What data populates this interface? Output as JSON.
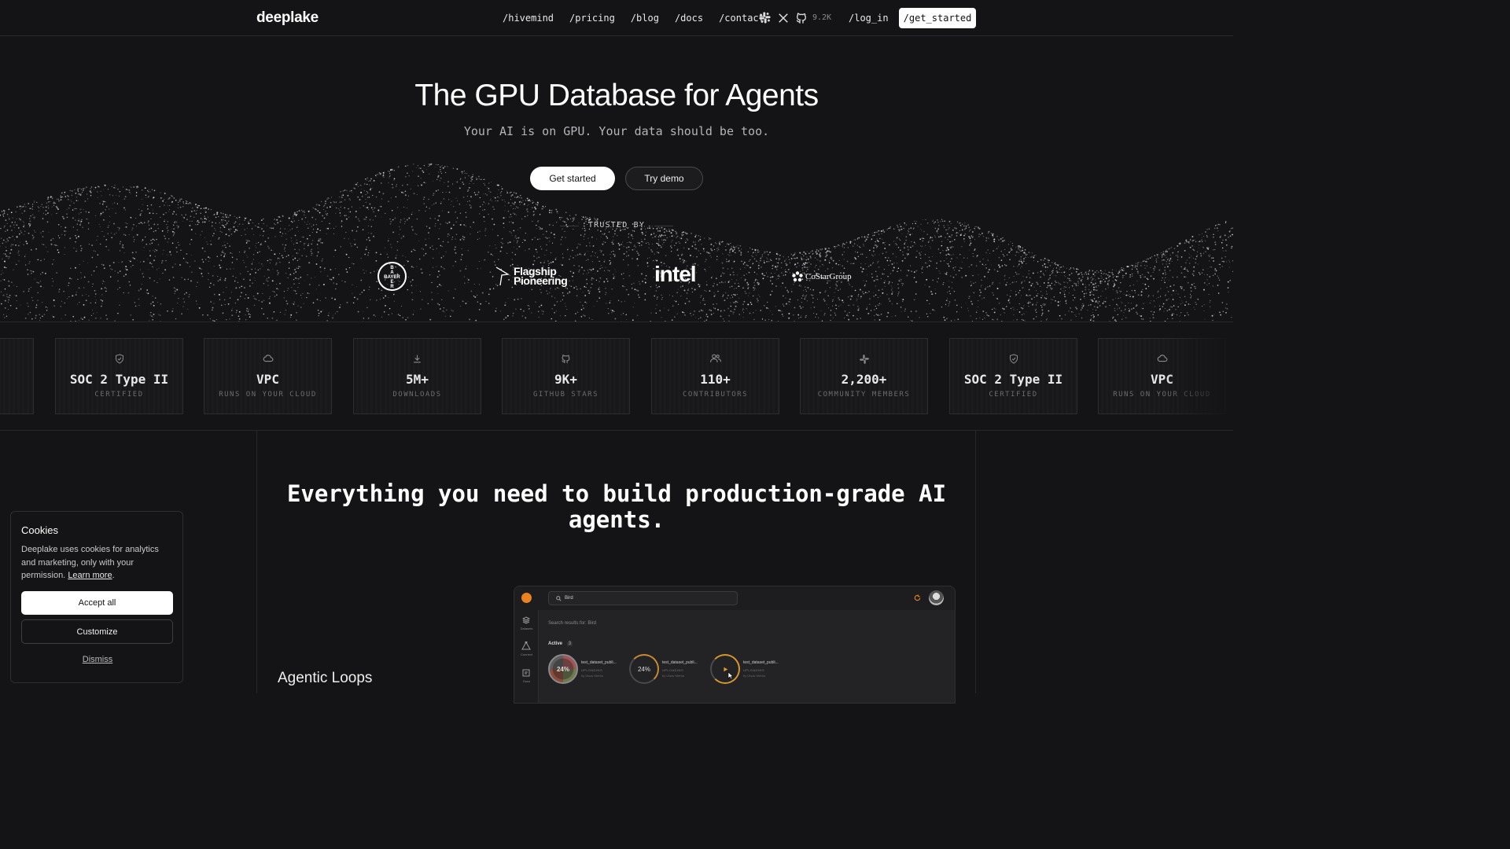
{
  "nav": {
    "logo": "deeplake",
    "links": [
      "/hivemind",
      "/pricing",
      "/blog",
      "/docs",
      "/contact"
    ],
    "github_stars": "9.2K",
    "login": "/log_in",
    "get_started": "/get_started",
    "icons": [
      "slack-icon",
      "x-icon",
      "github-icon"
    ]
  },
  "hero": {
    "title": "The GPU Database for Agents",
    "subtitle": "Your AI is on GPU. Your data should be too.",
    "primary_button": "Get started",
    "secondary_button": "Try demo",
    "trusted_by": "TRUSTED BY",
    "brands": {
      "bayer": [
        "B",
        "A",
        "BAYER",
        "E",
        "R"
      ],
      "flagship_line1": "Flagship",
      "flagship_line2": "Pioneering",
      "intel": "intel",
      "costar": "CoStarGroup"
    }
  },
  "stats": [
    {
      "icon": "shield-icon",
      "value": "SOC 2 Type II",
      "label": "CERTIFIED"
    },
    {
      "icon": "cloud-icon",
      "value": "VPC",
      "label": "RUNS ON YOUR CLOUD"
    },
    {
      "icon": "download-icon",
      "value": "5M+",
      "label": "DOWNLOADS"
    },
    {
      "icon": "github-icon",
      "value": "9K+",
      "label": "GITHUB STARS"
    },
    {
      "icon": "users-icon",
      "value": "110+",
      "label": "CONTRIBUTORS"
    },
    {
      "icon": "slack-icon",
      "value": "2,200+",
      "label": "COMMUNITY MEMBERS"
    },
    {
      "icon": "shield-icon",
      "value": "SOC 2 Type II",
      "label": "CERTIFIED"
    },
    {
      "icon": "cloud-icon",
      "value": "VPC",
      "label": "RUNS ON YOUR CLOUD"
    }
  ],
  "section": {
    "title": "Everything you need to build production-grade AI agents.",
    "feature": "Agentic Loops"
  },
  "app_preview": {
    "search_value": "Bird",
    "results_label": "Search results for: Bird",
    "active_label": "Active",
    "active_count": "3",
    "sidebar": [
      "Datasets",
      "Connect",
      "Docs"
    ],
    "items": [
      {
        "progress": "24%",
        "title": "test_dataset_publi...",
        "status": "UPLOADING",
        "by": "by Utsav Mehta"
      },
      {
        "progress": "24%",
        "title": "test_dataset_publi...",
        "status": "UPLOADING",
        "by": "by Utsav Mehta"
      },
      {
        "progress": "",
        "title": "test_dataset_publi...",
        "status": "UPLOADING",
        "by": "by Utsav Mehta"
      }
    ]
  },
  "cookie": {
    "title": "Cookies",
    "text": "Deeplake uses cookies for analytics and marketing, only with your permission.",
    "learn_more": "Learn more",
    "accept": "Accept all",
    "customize": "Customize",
    "dismiss": "Dismiss"
  }
}
